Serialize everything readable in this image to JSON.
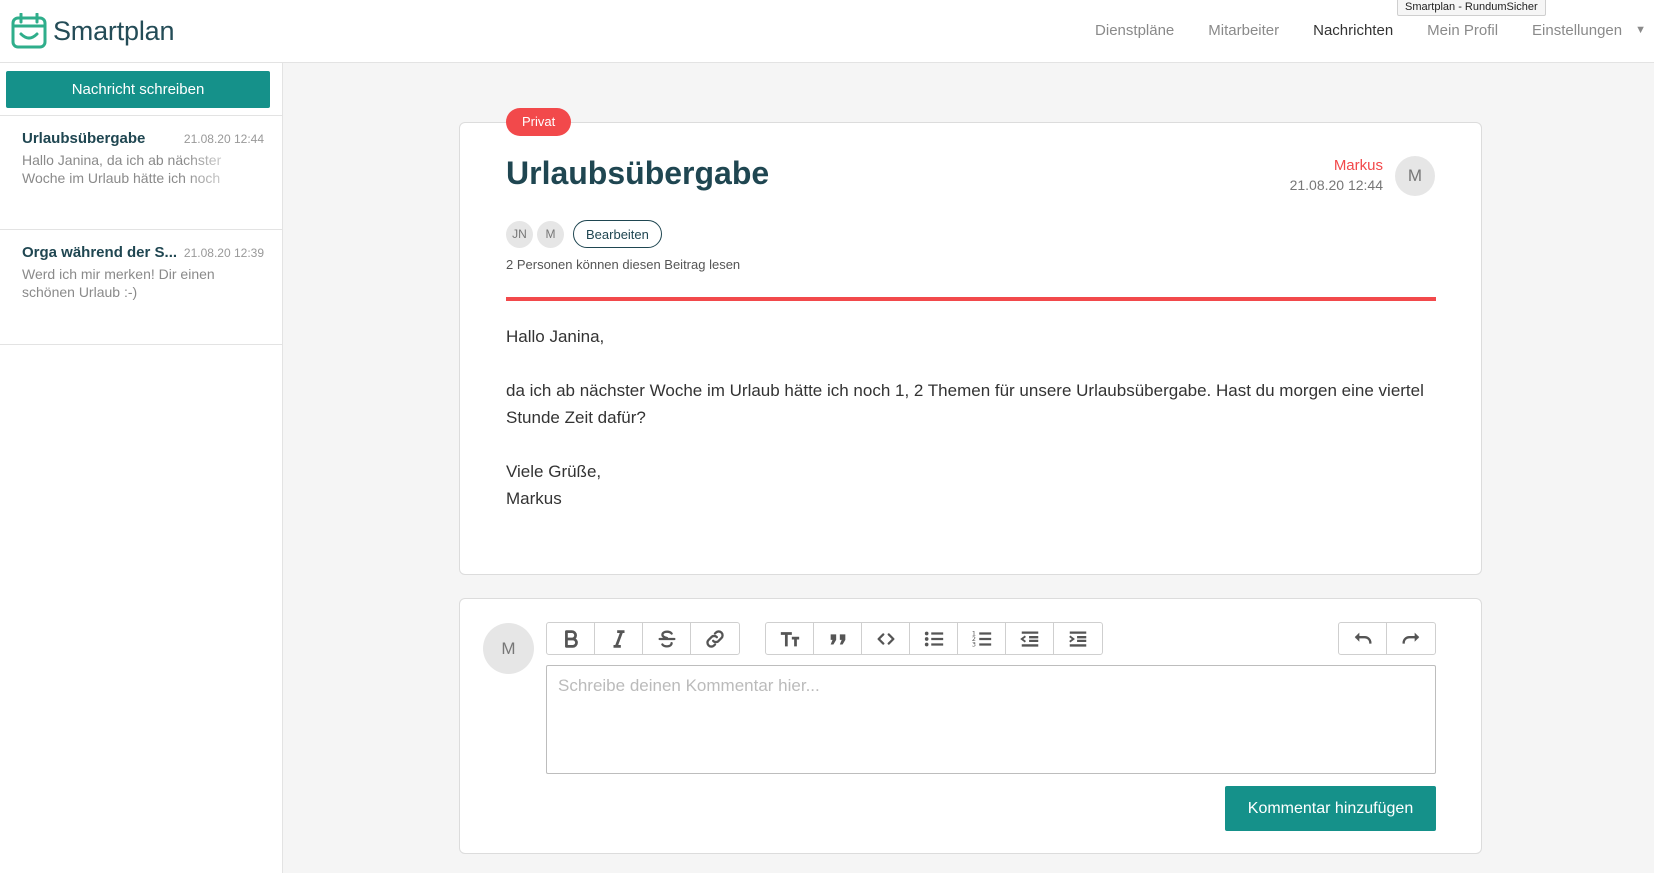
{
  "app": {
    "name": "Smartplan"
  },
  "tooltip": "Smartplan - RundumSicher",
  "nav": [
    {
      "label": "Dienstpläne"
    },
    {
      "label": "Mitarbeiter"
    },
    {
      "label": "Nachrichten"
    },
    {
      "label": "Mein Profil"
    },
    {
      "label": "Einstellungen"
    }
  ],
  "sidebar": {
    "compose_label": "Nachricht schreiben",
    "messages": [
      {
        "subject": "Urlaubsübergabe",
        "date": "21.08.20 12:44",
        "preview": "Hallo Janina, da ich ab nächster Woche im Urlaub hätte ich noch"
      },
      {
        "subject": "Orga während der S...",
        "date": "21.08.20 12:39",
        "preview": "Werd ich mir merken! Dir einen schönen Urlaub :-)"
      }
    ]
  },
  "message": {
    "badge": "Privat",
    "title": "Urlaubsübergabe",
    "author": "Markus",
    "date": "21.08.20 12:44",
    "author_initial": "M",
    "readers": [
      "JN",
      "M"
    ],
    "edit_label": "Bearbeiten",
    "readers_text": "2 Personen können diesen Beitrag lesen",
    "body": {
      "greeting": "Hallo Janina,",
      "paragraph": "da ich ab nächster Woche im Urlaub hätte ich noch 1, 2 Themen für unsere Urlaubsübergabe. Hast du morgen eine viertel Stunde Zeit dafür?",
      "closing": "Viele Grüße,",
      "signature": "Markus"
    }
  },
  "comment": {
    "avatar_initial": "M",
    "placeholder": "Schreibe deinen Kommentar hier...",
    "submit_label": "Kommentar hinzufügen"
  },
  "colors": {
    "accent": "#15918a",
    "brand_dark": "#1f4651",
    "alert": "#f2494b"
  }
}
